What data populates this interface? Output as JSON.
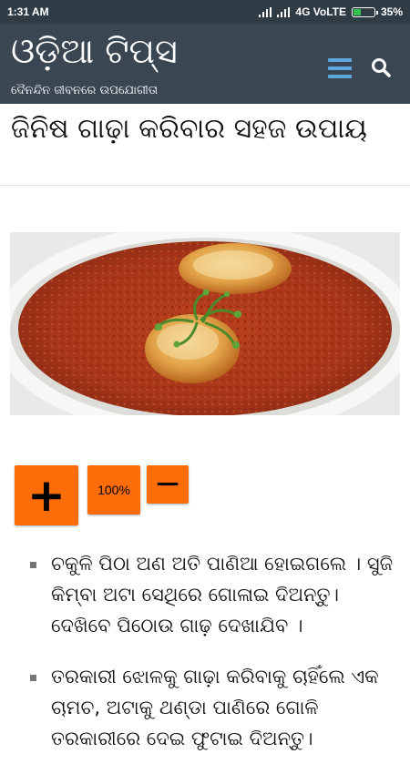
{
  "status_bar": {
    "time": "1:31 AM",
    "network": "4G VoLTE",
    "battery_percent": "35%",
    "battery_level": 0.35,
    "battery_color": "#35c24c"
  },
  "app_bar": {
    "site_title": "ଓଡ଼ିଆ ଟିପ୍ସ",
    "site_subtitle": "ଦୈନନ୍ଦିନ ଜୀବନରେ ଉପଯୋଗୀତା",
    "menu_icon": "hamburger-menu-icon",
    "search_icon": "search-icon",
    "accent_color": "#5ea7df",
    "background": "#3a4753"
  },
  "post": {
    "title": "ଜିନିଷ ଗାଢ଼ା କରିବାର ସହଜ ଉପାୟ",
    "image_description": "curry-with-eggs-photo"
  },
  "zoom_controls": {
    "increase_label": "+",
    "level": "100%",
    "decrease_label": "−",
    "color": "#ff6d0a"
  },
  "tips": [
    "ଚକୁଳି ପିଠା ଅଣ ଅତି ପାଣିଆ ହୋଇଗଲେ । ସୁଜି କିମ୍ବା ଅଟା ସେଥିରେ ଗୋଳାଇ ଦିଅନ୍ତୁ। ଦେଖିବେ ପିଠୋଉ ଗାଢ଼ ଦେଖାଯିବ ।",
    "ତରକାରୀ ଝୋଳକୁ ଗାଢ଼ା କରିବାକୁ ଚାହିଁଲେ ଏକ ଚାମଚ, ଅଟାକୁ ଥଣ୍ଡା ପାଣିରେ ଗୋଳି ତରକାରୀରେ ଦେଇ ଫୁଟାଇ ଦିଅନ୍ତୁ।"
  ]
}
